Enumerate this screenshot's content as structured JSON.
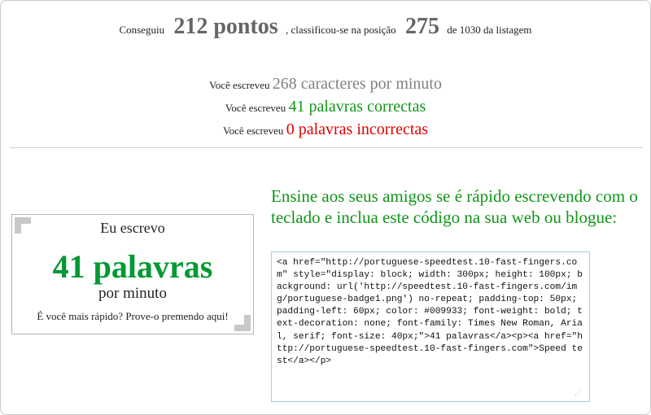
{
  "result": {
    "prefix": "Conseguiu",
    "points": "212 pontos",
    "middle": ", classificou-se na posição",
    "rank": "275",
    "suffix": "de 1030 da listagem"
  },
  "stats": [
    {
      "label": "Você escreveu",
      "value": "268 caracteres por minuto"
    },
    {
      "label": "Você escreveu",
      "value": "41 palavras correctas"
    },
    {
      "label": "Você escreveu",
      "value": "0 palavras incorrectas"
    }
  ],
  "badge": {
    "line1": "Eu escrevo",
    "line2": "41 palavras",
    "line3": "por minuto",
    "line4": "É você mais rápido? Prove-o premendo aqui!"
  },
  "share": {
    "text": "Ensine aos seus amigos se é rápido escrevendo com o teclado e inclua este código na sua web ou blogue:",
    "code": "<a href=\"http://portuguese-speedtest.10-fast-fingers.com\" style=\"display: block; width: 300px; height: 100px; background: url('http://speedtest.10-fast-fingers.com/img/portuguese-badge1.png') no-repeat; padding-top: 50px; padding-left: 60px; color: #009933; font-weight: bold; text-decoration: none; font-family: Times New Roman, Arial, serif; font-size: 40px;\">41 palavras</a><p><a href=\"http://portuguese-speedtest.10-fast-fingers.com\">Speed test</a></p>"
  },
  "colors": {
    "correct": "#109618",
    "incorrect": "#e00000",
    "neutral": "#808080",
    "badge_green": "#009933"
  }
}
